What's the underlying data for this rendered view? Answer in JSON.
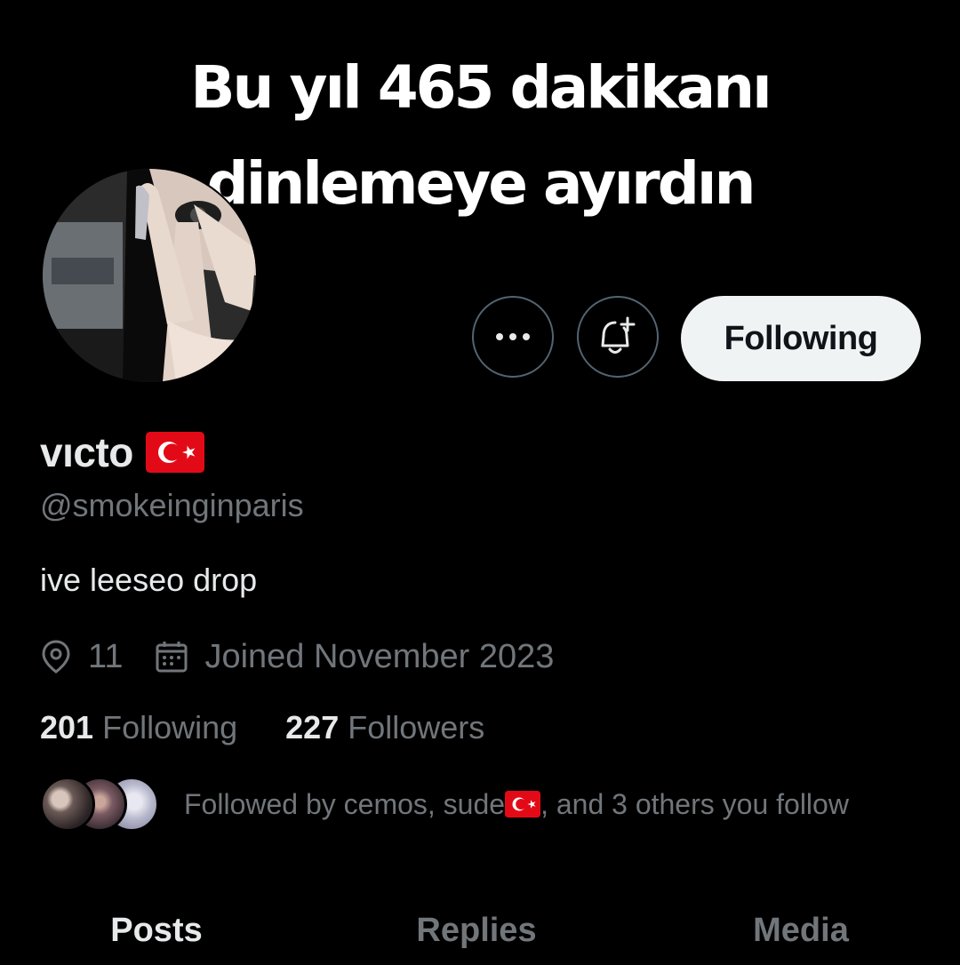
{
  "banner": {
    "line1": "Bu yıl 465 dakikanı",
    "line2": "dinlemeye ayırdın"
  },
  "header": {
    "more_icon": "more-icon",
    "notification_icon": "bell-plus-icon",
    "following_button": "Following"
  },
  "profile": {
    "display_name": "vıcto",
    "flag_icon": "turkey-flag-icon",
    "handle": "@smokeinginparis",
    "bio": "ive leeseo drop",
    "location": "11",
    "joined": "Joined November 2023",
    "following_count": "201",
    "following_label": "Following",
    "followers_count": "227",
    "followers_label": "Followers",
    "followed_by_prefix": "Followed by cemos, sude",
    "followed_by_suffix": ", and 3 others you follow"
  },
  "tabs": [
    {
      "label": "Posts",
      "active": true
    },
    {
      "label": "Replies",
      "active": false
    },
    {
      "label": "Media",
      "active": false
    }
  ],
  "colors": {
    "background": "#000000",
    "text_primary": "#e7e9ea",
    "text_secondary": "#71767b",
    "button_light": "#eff3f4",
    "flag_red": "#e30a17"
  }
}
